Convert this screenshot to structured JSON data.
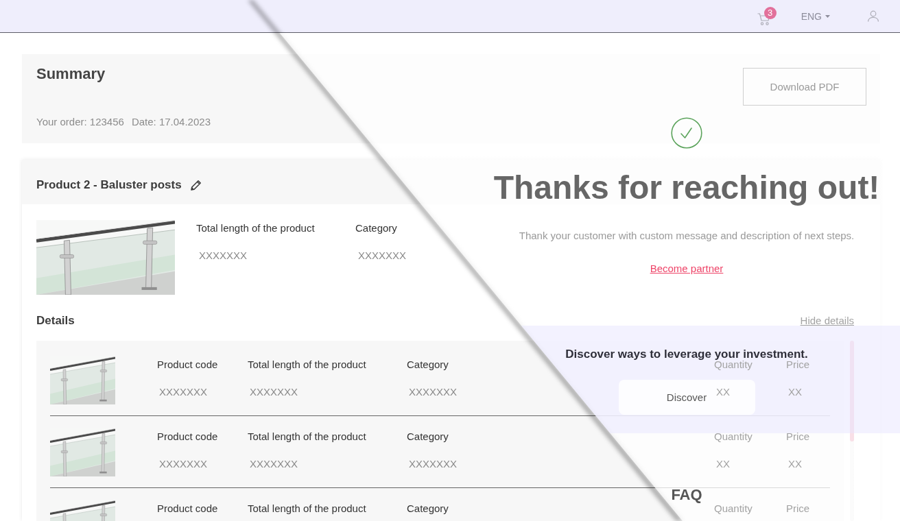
{
  "header": {
    "cart_count": "3",
    "language": "ENG"
  },
  "summary": {
    "title": "Summary",
    "order": "Your order: 123456",
    "date": "Date: 17.04.2023",
    "download_button": "Download PDF"
  },
  "product": {
    "title": "Product 2 - Baluster posts",
    "fields": [
      {
        "label": "Total length of the product",
        "value": "XXXXXXX"
      },
      {
        "label": "Category",
        "value": "XXXXXXX"
      }
    ]
  },
  "details": {
    "title": "Details",
    "hide_link": "Hide details",
    "rows": [
      {
        "fields": [
          {
            "label": "Product code",
            "value": "XXXXXXX"
          },
          {
            "label": "Total length of the product",
            "value": "XXXXXXX"
          },
          {
            "label": "Category",
            "value": "XXXXXXX"
          },
          {
            "label": "Quantity",
            "value": "XX"
          },
          {
            "label": "Price",
            "value": "XX"
          }
        ]
      },
      {
        "fields": [
          {
            "label": "Product code",
            "value": "XXXXXXX"
          },
          {
            "label": "Total length of the product",
            "value": "XXXXXXX"
          },
          {
            "label": "Category",
            "value": "XXXXXXX"
          },
          {
            "label": "Quantity",
            "value": "XX"
          },
          {
            "label": "Price",
            "value": "XX"
          }
        ]
      },
      {
        "fields": [
          {
            "label": "Product code"
          },
          {
            "label": "Total length of the product"
          },
          {
            "label": "Category"
          },
          {
            "label": "Quantity"
          },
          {
            "label": "Price"
          }
        ]
      }
    ]
  },
  "thanks": {
    "title": "Thanks for reaching out!",
    "message": "Thank your customer with custom message and description of next steps.",
    "link": "Become partner",
    "promo": {
      "heading": "Discover ways to leverage your investment.",
      "button": "Discover"
    },
    "faq_title": "FAQ"
  }
}
